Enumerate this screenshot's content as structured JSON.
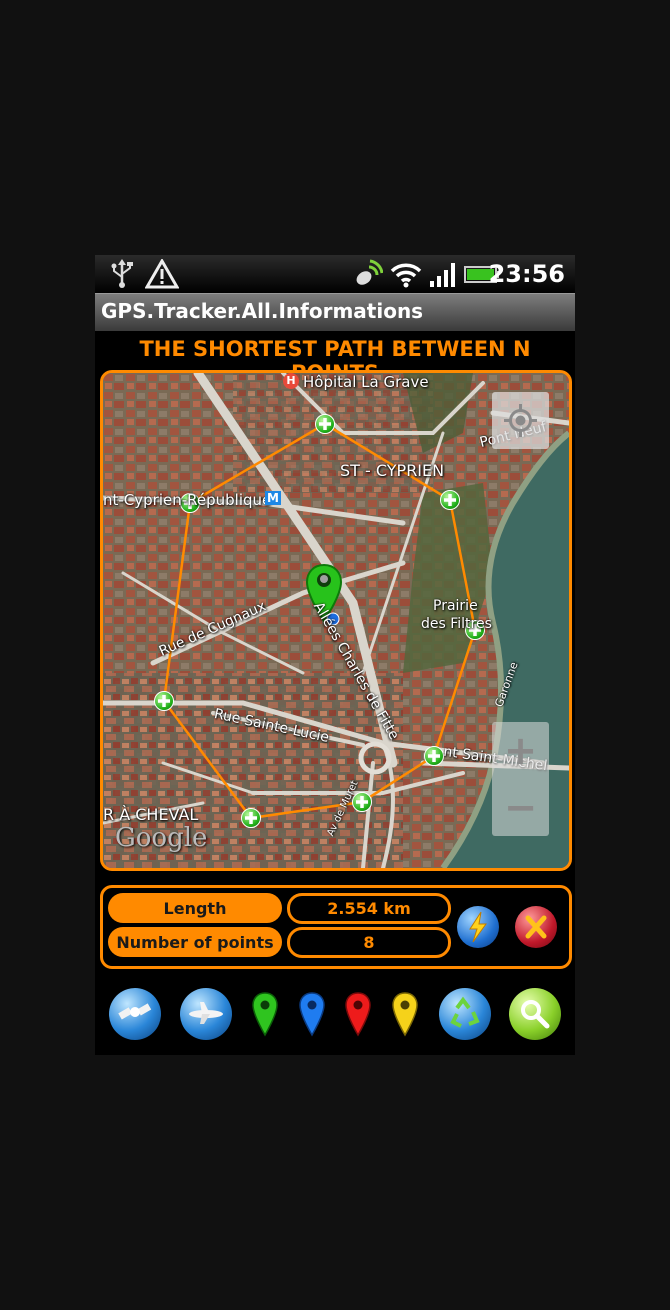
{
  "status_bar": {
    "time": "23:56",
    "icons": [
      "usb-icon",
      "warning-icon",
      "gps-icon",
      "wifi-icon",
      "signal-icon",
      "battery-icon"
    ]
  },
  "app": {
    "title": "GPS.Tracker.All.Informations"
  },
  "heading": "THE SHORTEST PATH BETWEEN N POINTS",
  "map": {
    "labels": {
      "hopital": "Hôpital La Grave",
      "pont_neuf": "Pont Neuf",
      "st_cyprien": "ST - CYPRIEN",
      "republique": "nt-Cyprien-République",
      "prairie1": "Prairie",
      "prairie2": "des Filtres",
      "cugnaux": "Rue de Cugnaux",
      "charles": "Allées Charles de Fitte",
      "garonne": "Garonne",
      "sainte_lucie": "Rue Sainte-Lucie",
      "saint_michel": "nt Saint-Michel",
      "cheval": "R À CHEVAL",
      "muret": "Av de Muret",
      "google": "Google"
    },
    "metro_badge": "M",
    "hospital_badge": "H",
    "zoom_in": "+",
    "zoom_out": "−",
    "waypoint_count": 8
  },
  "info": {
    "length_label": "Length",
    "length_value": "2.554 km",
    "points_label": "Number of points",
    "points_value": "8"
  },
  "colors": {
    "accent": "#ff8a00",
    "route": "#ff8a00"
  },
  "toolbar": [
    "satellite-button",
    "plane-button",
    "green-marker-button",
    "blue-marker-button",
    "red-marker-button",
    "yellow-marker-button",
    "recycle-button",
    "search-button"
  ]
}
